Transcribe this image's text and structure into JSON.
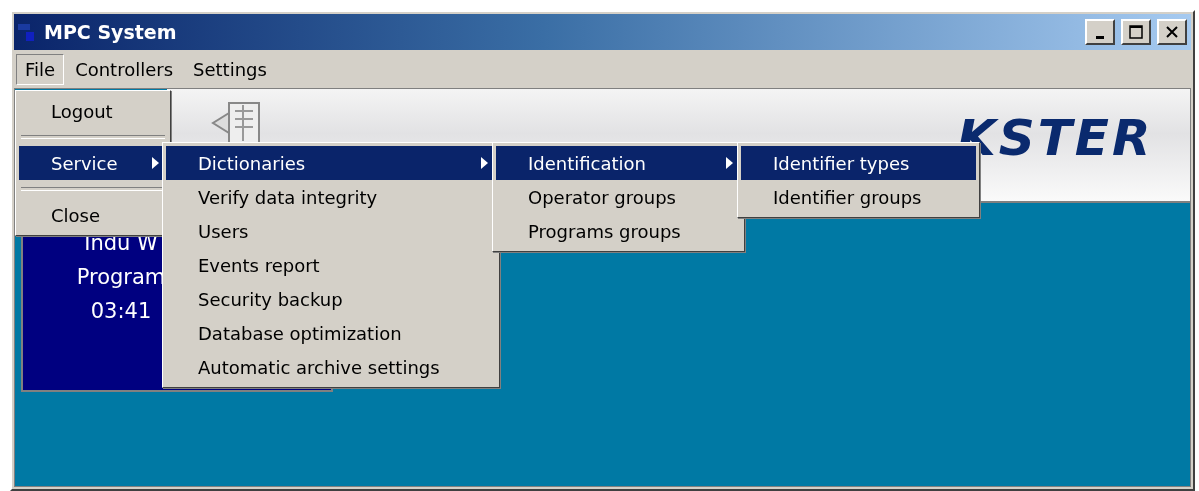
{
  "window": {
    "title": "MPC System"
  },
  "menu_bar": [
    {
      "label": "File",
      "selected": true
    },
    {
      "label": "Controllers",
      "selected": false
    },
    {
      "label": "Settings",
      "selected": false
    }
  ],
  "header": {
    "logo": "KSTER"
  },
  "tile": {
    "lines": [
      "Indu W",
      "Program",
      "03:41"
    ]
  },
  "open_menus": [
    {
      "items": [
        {
          "kind": "item",
          "label": "Logout",
          "selected": false,
          "submenu": false
        },
        {
          "kind": "separator"
        },
        {
          "kind": "item",
          "label": "Service",
          "selected": true,
          "submenu": true
        },
        {
          "kind": "separator"
        },
        {
          "kind": "item",
          "label": "Close",
          "selected": false,
          "submenu": false
        }
      ]
    },
    {
      "items": [
        {
          "kind": "item",
          "label": "Dictionaries",
          "selected": true,
          "submenu": true
        },
        {
          "kind": "item",
          "label": "Verify data integrity",
          "selected": false,
          "submenu": false
        },
        {
          "kind": "item",
          "label": "Users",
          "selected": false,
          "submenu": false
        },
        {
          "kind": "item",
          "label": "Events report",
          "selected": false,
          "submenu": false
        },
        {
          "kind": "item",
          "label": "Security backup",
          "selected": false,
          "submenu": false
        },
        {
          "kind": "item",
          "label": "Database optimization",
          "selected": false,
          "submenu": false
        },
        {
          "kind": "item",
          "label": "Automatic archive settings",
          "selected": false,
          "submenu": false
        }
      ]
    },
    {
      "items": [
        {
          "kind": "item",
          "label": "Identification",
          "selected": true,
          "submenu": true
        },
        {
          "kind": "item",
          "label": "Operator groups",
          "selected": false,
          "submenu": false
        },
        {
          "kind": "item",
          "label": "Programs groups",
          "selected": false,
          "submenu": false
        }
      ]
    },
    {
      "items": [
        {
          "kind": "item",
          "label": "Identifier types",
          "selected": true,
          "submenu": false
        },
        {
          "kind": "item",
          "label": "Identifier groups",
          "selected": false,
          "submenu": false
        }
      ]
    }
  ]
}
